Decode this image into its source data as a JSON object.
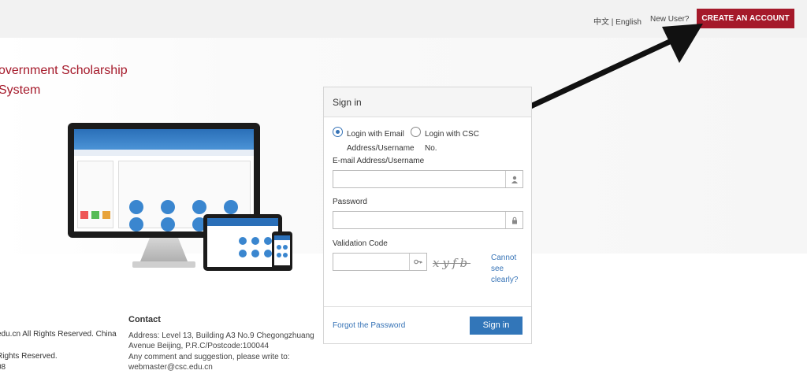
{
  "topbar": {
    "lang_cn": "中文",
    "lang_sep": " | ",
    "lang_en": "English",
    "new_user": "New User?",
    "create_account": "CREATE AN ACCOUNT"
  },
  "hero": {
    "title_line1": "overnment Scholarship",
    "title_line2": "System"
  },
  "signin": {
    "heading": "Sign in",
    "radio_email_line1": "Login with Email",
    "radio_email_line2": "Address/Username",
    "radio_csc_line1": "Login with CSC",
    "radio_csc_line2": "No.",
    "email_label": "E-mail Address/Username",
    "password_label": "Password",
    "validation_label": "Validation Code",
    "captcha_text": "xyfb",
    "cannot_see": "Cannot see clearly?",
    "forgot": "Forgot the Password",
    "submit": "Sign in"
  },
  "footer": {
    "copy_line1": "edu.cn All Rights Reserved. China",
    "copy_line2": "Rights Reserved.",
    "copy_line3": "08",
    "contact_heading": "Contact",
    "contact_address1": "Address: Level 13, Building A3 No.9 Chegongzhuang",
    "contact_address2": "Avenue Beijing, P.R.C/Postcode:100044",
    "contact_comment": "Any comment and suggestion, please write to:",
    "contact_email": "webmaster@csc.edu.cn"
  },
  "colors": {
    "brand_red": "#a5192a",
    "link_blue": "#3673b6",
    "button_blue": "#3276b9"
  },
  "icons": [
    "user-icon",
    "lock-icon",
    "key-icon",
    "arrow-annotation"
  ]
}
